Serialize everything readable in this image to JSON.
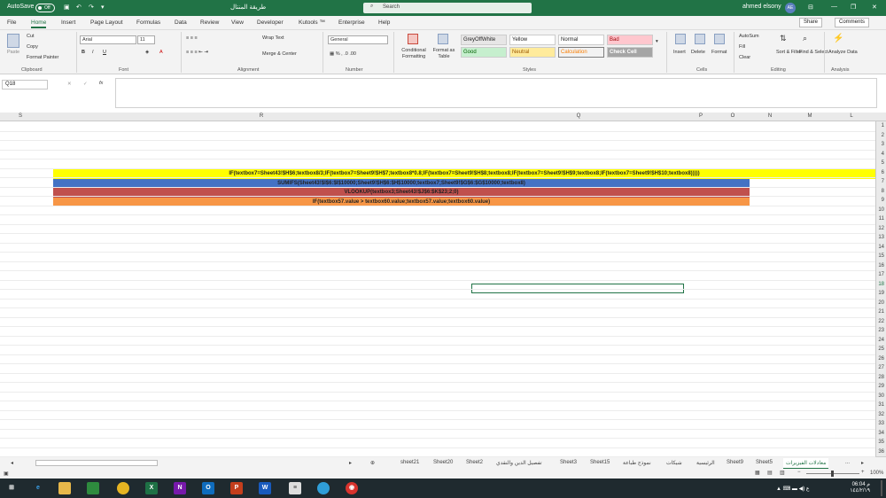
{
  "titlebar": {
    "autosave_label": "AutoSave",
    "autosave_state": "Off",
    "doc_title": "طريقة المنتال",
    "search_placeholder": "Search",
    "user_name": "ahmed elsony",
    "user_initials": "AE"
  },
  "menu": {
    "tabs": [
      "File",
      "Home",
      "Insert",
      "Page Layout",
      "Formulas",
      "Data",
      "Review",
      "View",
      "Developer",
      "Kutools ™",
      "Enterprise",
      "Help"
    ],
    "active": "Home",
    "share_label": "Share",
    "comments_label": "Comments"
  },
  "ribbon": {
    "clipboard": {
      "cut": "Cut",
      "copy": "Copy",
      "paste": "Paste",
      "format_painter": "Format Painter",
      "group": "Clipboard"
    },
    "font": {
      "name": "Arial",
      "size": "11",
      "group": "Font"
    },
    "alignment": {
      "wrap": "Wrap Text",
      "merge": "Merge & Center",
      "group": "Alignment"
    },
    "number": {
      "format": "General",
      "group": "Number"
    },
    "styles": {
      "conditional": "Conditional Formatting",
      "format_table": "Format as Table",
      "cells": [
        "GreyOffWhite",
        "Yellow",
        "Normal",
        "Bad",
        "Good",
        "Neutral",
        "Calculation",
        "Check Cell"
      ],
      "group": "Styles"
    },
    "cells": {
      "insert": "Insert",
      "delete": "Delete",
      "format": "Format",
      "group": "Cells"
    },
    "editing": {
      "autosum": "AutoSum",
      "fill": "Fill",
      "clear": "Clear",
      "sort": "Sort & Filter",
      "find": "Find & Select",
      "group": "Editing"
    },
    "analysis": {
      "analyze": "Analyze Data",
      "group": "Analysis"
    }
  },
  "formula_bar": {
    "name_box": "Q18",
    "fx": "fx",
    "content": ""
  },
  "columns": [
    "S",
    "R",
    "Q",
    "P",
    "O",
    "N",
    "M",
    "L"
  ],
  "formulas": [
    "IF(textbox7=Sheet43!$H$6;textbox8/3;IF(textbox7=Sheet9!$H$7;textbox8*0.8;IF(textbox7=Sheet9!$H$8;textbox8;IF(textbox7=Sheet9!$H$9;textbox8;IF(textbox7=Sheet9!$H$10;textbox8)))))",
    "SUMIFS(Sheet43!$I$6:$I$10000;Sheet9!$H$6:$H$10000;textbox7;Sheet9!$G$6:$G$10000;textbox8)",
    "VLOOKUP(textbox3;Sheet43!$J$6:$K$23;2;0)",
    "IF(textbox57.value > textbox60.value;textbox57.value;textbox60.value)"
  ],
  "row_colors": [
    "#ffff00",
    "#4472c4",
    "#c0504d",
    "#f79646"
  ],
  "selected_row": 18,
  "sheet_tabs": [
    "sheet21",
    "Sheet20",
    "Sheet2",
    "تفصيل الدين والنقدي",
    "Sheet3",
    "Sheet15",
    "نموذج طباعة",
    "شيكات",
    "الرئيسية",
    "Sheet9",
    "Sheet5",
    "معادلات الفيزيرات",
    "..."
  ],
  "active_sheet": "معادلات الفيزيرات",
  "status": {
    "zoom": "100%"
  },
  "clock": {
    "time": "06:04 م",
    "date": "١٤٤/٢/١٩"
  }
}
